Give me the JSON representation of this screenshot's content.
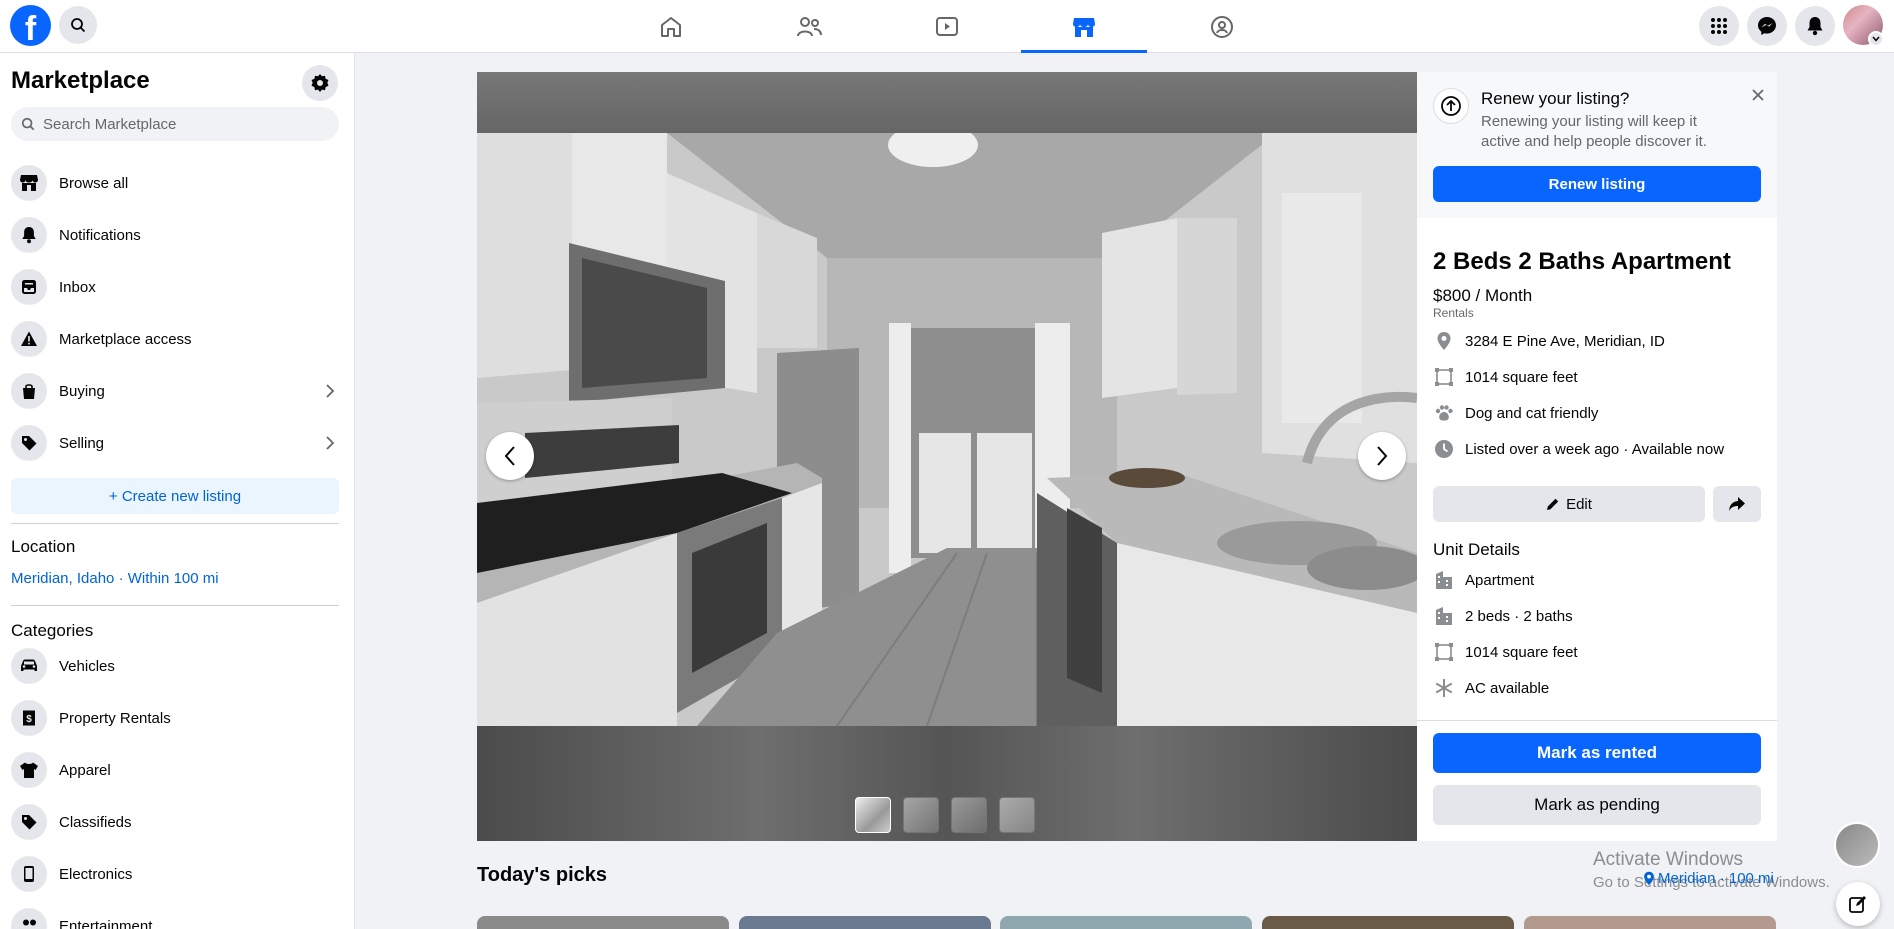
{
  "topbar": {
    "logo": "f",
    "nav_icons": [
      "home-icon",
      "friends-icon",
      "watch-icon",
      "marketplace-icon",
      "groups-icon"
    ],
    "active_tab": "marketplace",
    "accent": "#0866ff"
  },
  "sidebar": {
    "title": "Marketplace",
    "search_placeholder": "Search Marketplace",
    "items": [
      {
        "label": "Browse all",
        "icon": "storefront-icon"
      },
      {
        "label": "Notifications",
        "icon": "bell-icon"
      },
      {
        "label": "Inbox",
        "icon": "inbox-icon"
      },
      {
        "label": "Marketplace access",
        "icon": "warning-icon"
      },
      {
        "label": "Buying",
        "icon": "bag-icon"
      },
      {
        "label": "Selling",
        "icon": "tag-icon"
      }
    ],
    "create_listing": "+ Create new listing",
    "location_heading": "Location",
    "location_value": "Meridian, Idaho · Within 100 mi",
    "categories_heading": "Categories",
    "categories": [
      {
        "label": "Vehicles",
        "icon": "car-icon"
      },
      {
        "label": "Property Rentals",
        "icon": "house-icon"
      },
      {
        "label": "Apparel",
        "icon": "shirt-icon"
      },
      {
        "label": "Classifieds",
        "icon": "tag-icon"
      },
      {
        "label": "Electronics",
        "icon": "phone-icon"
      },
      {
        "label": "Entertainment",
        "icon": "people-icon"
      }
    ]
  },
  "renew": {
    "title": "Renew your listing?",
    "description": "Renewing your listing will keep it active and help people discover it.",
    "button": "Renew listing"
  },
  "listing": {
    "title": "2 Beds 2 Baths Apartment",
    "price": "$800 / Month",
    "category": "Rentals",
    "details": [
      {
        "text": "3284 E Pine Ave, Meridian, ID",
        "icon": "location-pin-icon"
      },
      {
        "text": "1014 square feet",
        "icon": "area-icon"
      },
      {
        "text": "Dog and cat friendly",
        "icon": "paw-icon"
      },
      {
        "text": "Listed over a week ago · Available now",
        "icon": "clock-icon"
      }
    ],
    "edit_label": "Edit",
    "unit_heading": "Unit Details",
    "unit_details": [
      {
        "text": "Apartment",
        "icon": "building-icon"
      },
      {
        "text": "2 beds · 2 baths",
        "icon": "building-icon"
      },
      {
        "text": "1014 square feet",
        "icon": "area-icon"
      },
      {
        "text": "AC available",
        "icon": "snowflake-icon"
      }
    ],
    "mark_rented": "Mark as rented",
    "mark_pending": "Mark as pending",
    "photo_count": 4
  },
  "picks": {
    "title": "Today's picks"
  },
  "overlay": {
    "activate_title": "Activate Windows",
    "activate_sub": "Go to Settings to activate Windows.",
    "location_chip": "Meridian · 100 mi"
  }
}
